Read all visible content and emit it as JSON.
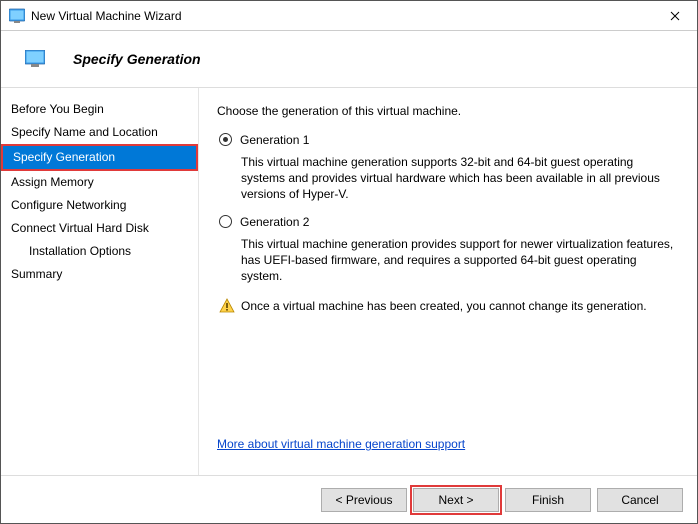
{
  "window": {
    "title": "New Virtual Machine Wizard"
  },
  "header": {
    "page_title": "Specify Generation"
  },
  "sidebar": {
    "items": [
      {
        "label": "Before You Begin",
        "selected": false,
        "indent": false
      },
      {
        "label": "Specify Name and Location",
        "selected": false,
        "indent": false
      },
      {
        "label": "Specify Generation",
        "selected": true,
        "indent": false
      },
      {
        "label": "Assign Memory",
        "selected": false,
        "indent": false
      },
      {
        "label": "Configure Networking",
        "selected": false,
        "indent": false
      },
      {
        "label": "Connect Virtual Hard Disk",
        "selected": false,
        "indent": false
      },
      {
        "label": "Installation Options",
        "selected": false,
        "indent": true
      },
      {
        "label": "Summary",
        "selected": false,
        "indent": false
      }
    ]
  },
  "content": {
    "intro": "Choose the generation of this virtual machine.",
    "option1": {
      "label": "Generation 1",
      "desc": "This virtual machine generation supports 32-bit and 64-bit guest operating systems and provides virtual hardware which has been available in all previous versions of Hyper-V.",
      "checked": true
    },
    "option2": {
      "label": "Generation 2",
      "desc": "This virtual machine generation provides support for newer virtualization features, has UEFI-based firmware, and requires a supported 64-bit guest operating system.",
      "checked": false
    },
    "warning": "Once a virtual machine has been created, you cannot change its generation.",
    "more_link": "More about virtual machine generation support"
  },
  "footer": {
    "previous": "< Previous",
    "next": "Next >",
    "finish": "Finish",
    "cancel": "Cancel"
  }
}
